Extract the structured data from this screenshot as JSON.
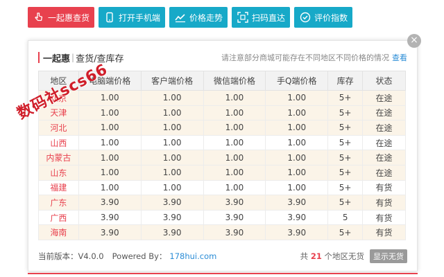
{
  "toolbar": {
    "buttons": [
      {
        "label": "一起惠查货",
        "icon": "hand-pointer-icon",
        "color": "#e8414e"
      },
      {
        "label": "打开手机端",
        "icon": "mobile-phone-icon",
        "color": "#17a9c8"
      },
      {
        "label": "价格走势",
        "icon": "trend-line-icon",
        "color": "#17a9c8"
      },
      {
        "label": "扫码直达",
        "icon": "qr-scan-icon",
        "color": "#17a9c8"
      },
      {
        "label": "评价指数",
        "icon": "check-circle-icon",
        "color": "#17a9c8"
      }
    ]
  },
  "panel": {
    "title": "一起惠",
    "separator": "|",
    "subtitle": "查货/查库存",
    "notice": "请注意部分商城可能存在不同地区不同价格的情况",
    "notice_link": "查看",
    "close_glyph": "×"
  },
  "table": {
    "headers": [
      "地区",
      "电脑端价格",
      "客户端价格",
      "微信端价格",
      "手Q端价格",
      "库存",
      "状态"
    ],
    "rows": [
      [
        "北京",
        "1.00",
        "1.00",
        "1.00",
        "1.00",
        "5+",
        "在途"
      ],
      [
        "天津",
        "1.00",
        "1.00",
        "1.00",
        "1.00",
        "5+",
        "在途"
      ],
      [
        "河北",
        "1.00",
        "1.00",
        "1.00",
        "1.00",
        "5+",
        "在途"
      ],
      [
        "山西",
        "1.00",
        "1.00",
        "1.00",
        "1.00",
        "5+",
        "在途"
      ],
      [
        "内蒙古",
        "1.00",
        "1.00",
        "1.00",
        "1.00",
        "5+",
        "在途"
      ],
      [
        "山东",
        "1.00",
        "1.00",
        "1.00",
        "1.00",
        "5+",
        "在途"
      ],
      [
        "福建",
        "1.00",
        "1.00",
        "1.00",
        "1.00",
        "5+",
        "有货"
      ],
      [
        "广东",
        "3.90",
        "3.90",
        "3.90",
        "3.90",
        "5+",
        "有货"
      ],
      [
        "广西",
        "3.90",
        "3.90",
        "3.90",
        "3.90",
        "5",
        "有货"
      ],
      [
        "海南",
        "3.90",
        "3.90",
        "3.90",
        "3.90",
        "5+",
        "有货"
      ]
    ]
  },
  "footer": {
    "version": "当前版本：V4.0.0",
    "powered_by": "Powered By：",
    "link": "178hui.com",
    "count_prefix": "共",
    "count": "21",
    "count_suffix": "个地区无货",
    "toggle_label": "显示无货"
  },
  "watermark": "数码社scs66",
  "colors": {
    "accent_red": "#e8414e",
    "accent_teal": "#17a9c8",
    "status_transit": "#18a8b8",
    "status_instock": "#1fa24a",
    "link_blue": "#2a8cd6"
  }
}
